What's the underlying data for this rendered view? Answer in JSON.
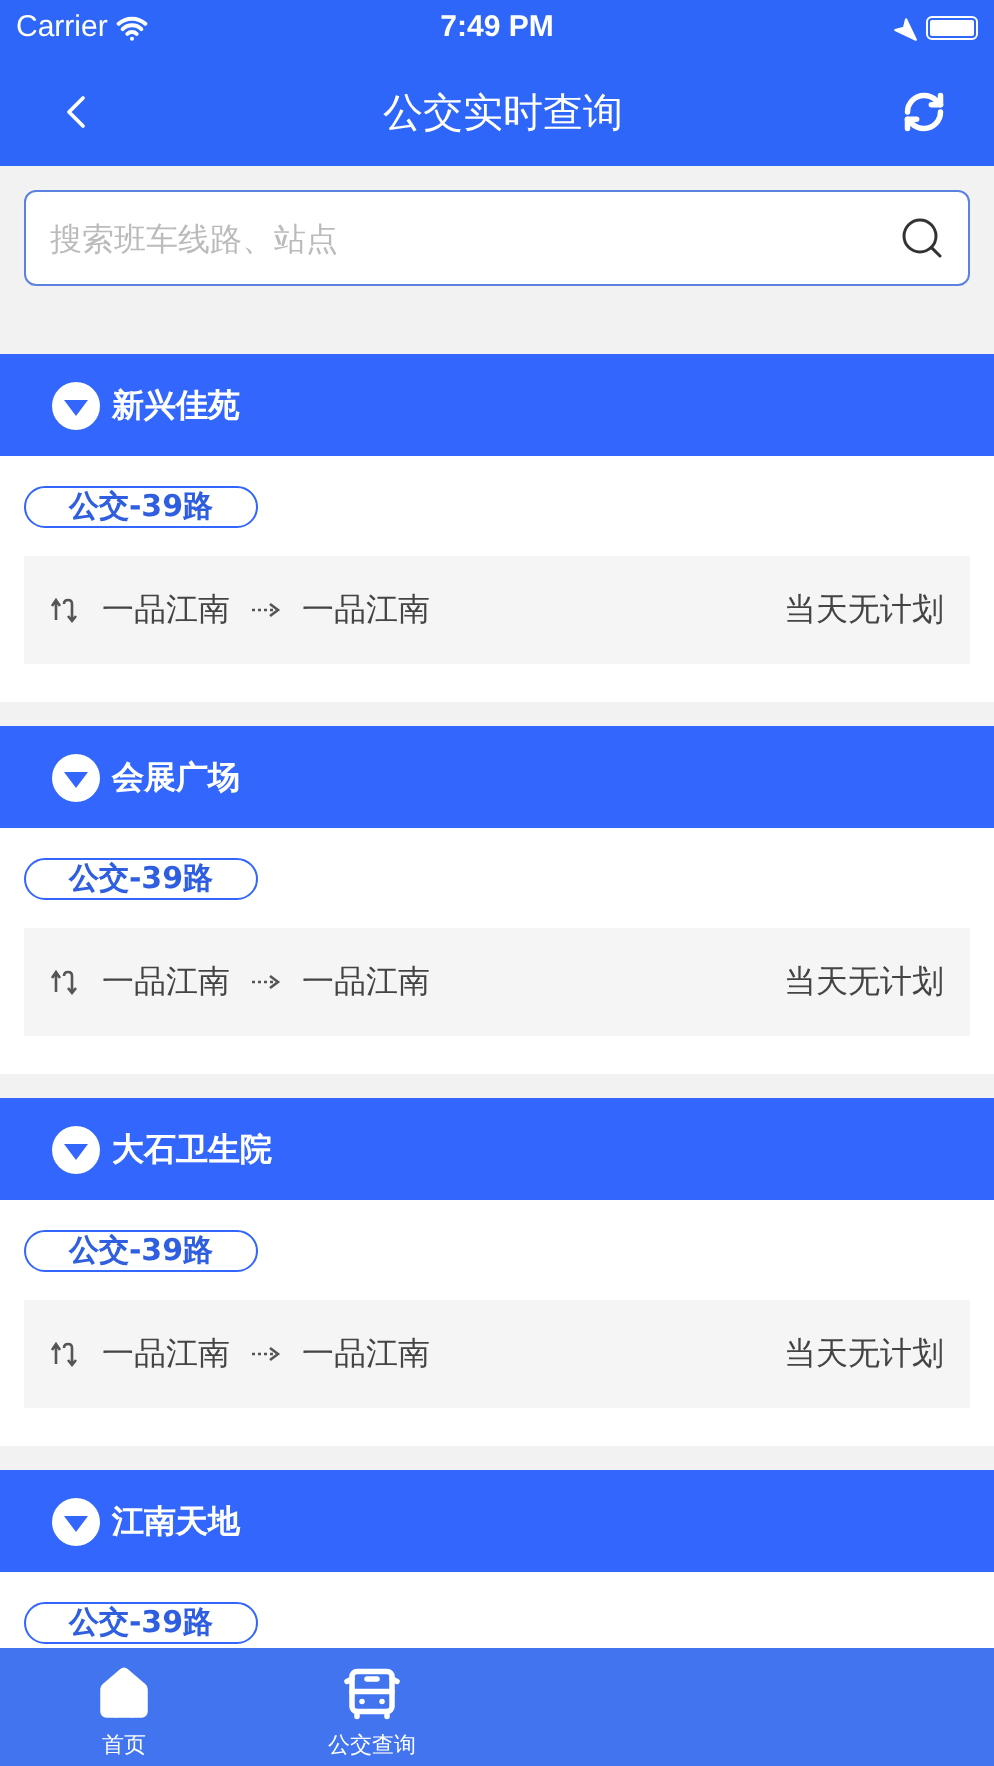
{
  "status_bar": {
    "carrier": "Carrier",
    "time": "7:49 PM"
  },
  "nav": {
    "title": "公交实时查询"
  },
  "search": {
    "placeholder": "搜索班车线路、站点"
  },
  "stops": [
    {
      "name": "新兴佳苑",
      "line": "公交-39路",
      "route": {
        "from": "一品江南",
        "to": "一品江南",
        "status": "当天无计划"
      }
    },
    {
      "name": "会展广场",
      "line": "公交-39路",
      "route": {
        "from": "一品江南",
        "to": "一品江南",
        "status": "当天无计划"
      }
    },
    {
      "name": "大石卫生院",
      "line": "公交-39路",
      "route": {
        "from": "一品江南",
        "to": "一品江南",
        "status": "当天无计划"
      }
    },
    {
      "name": "江南天地",
      "line": "公交-39路"
    }
  ],
  "tab_bar": [
    {
      "kind": "home",
      "label": "首页"
    },
    {
      "kind": "bus",
      "label": "公交查询"
    }
  ]
}
